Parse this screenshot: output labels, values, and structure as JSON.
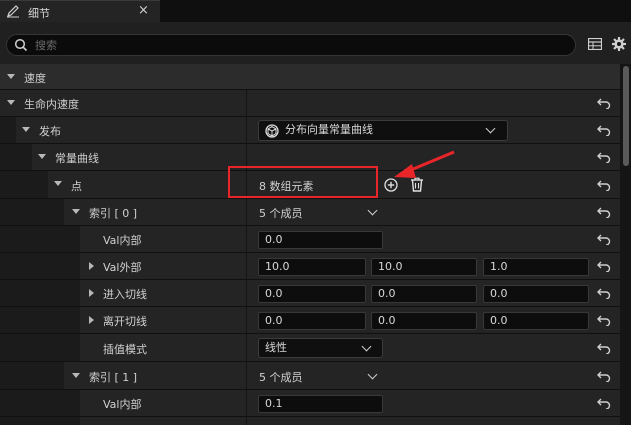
{
  "tab": {
    "title": "细节",
    "icon": "edit-icon",
    "close_label": "×"
  },
  "search": {
    "placeholder": "搜索",
    "icon": "search-icon"
  },
  "toolbar": {
    "table_icon": "table-view-icon",
    "settings_icon": "gear-icon"
  },
  "rows": {
    "speed_category": "速度",
    "lifetime_velocity": "生命内速度",
    "distribution": "发布",
    "distribution_value": "分布向量常量曲线",
    "const_curve": "常量曲线",
    "points": "点",
    "points_value": "8 数组元素",
    "index0": "索引 [ 0 ]",
    "index0_value": "5 个成员",
    "in_val": "Val内部",
    "in_val_value": "0.0",
    "out_val": "Val外部",
    "out_val_values": [
      "10.0",
      "10.0",
      "1.0"
    ],
    "arrive_tangent": "进入切线",
    "arrive_tangent_values": [
      "0.0",
      "0.0",
      "0.0"
    ],
    "leave_tangent": "离开切线",
    "leave_tangent_values": [
      "0.0",
      "0.0",
      "0.0"
    ],
    "interp_mode": "插值模式",
    "interp_mode_value": "线性",
    "index1": "索引 [ 1 ]",
    "index1_value": "5 个成员",
    "in_val_2": "Val内部",
    "in_val_2_value": "0.1"
  },
  "colors": {
    "annotation": "#e8262a",
    "background": "#151515"
  }
}
